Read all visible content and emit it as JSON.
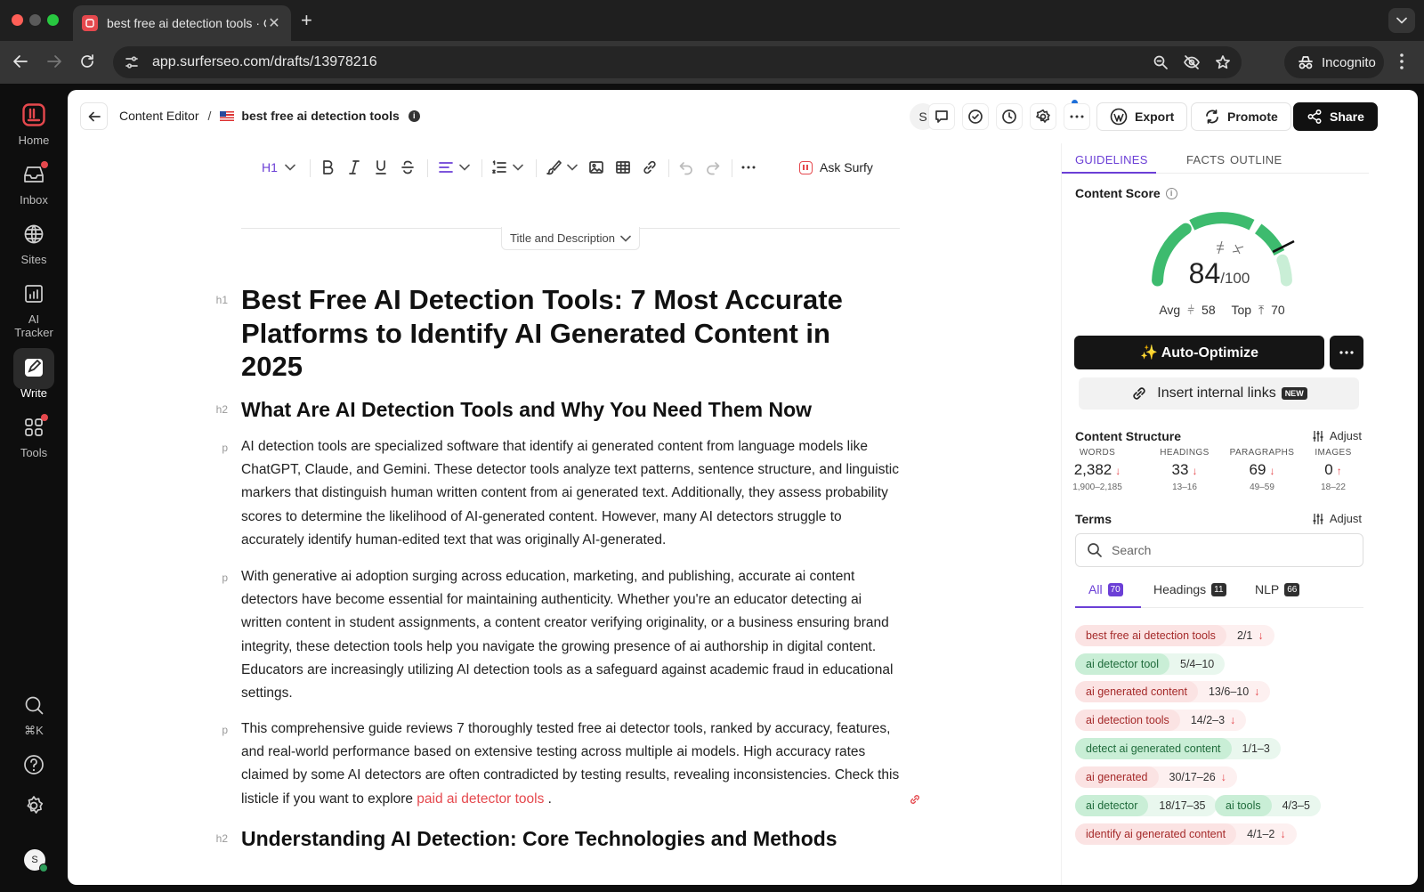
{
  "browser": {
    "tab_title": "best free ai detection tools · Content Editor",
    "url": "app.surferseo.com/drafts/13978216",
    "incognito_label": "Incognito"
  },
  "sidebar": {
    "items": [
      {
        "label": "Home",
        "icon": "home-icon"
      },
      {
        "label": "Inbox",
        "icon": "inbox-icon"
      },
      {
        "label": "Sites",
        "icon": "globe-icon"
      },
      {
        "label": "AI Tracker",
        "icon": "chart-icon"
      },
      {
        "label": "Write",
        "icon": "write-icon"
      },
      {
        "label": "Tools",
        "icon": "grid-icon"
      }
    ],
    "shortcut": "⌘K",
    "avatar_initial": "S"
  },
  "header": {
    "breadcrumb_root": "Content Editor",
    "breadcrumb_sep": "/",
    "doc_title": "best free ai detection tools",
    "user_badge": "S",
    "export_label": "Export",
    "promote_label": "Promote",
    "share_label": "Share"
  },
  "editor": {
    "heading_select": "H1",
    "ask_surfy": "Ask Surfy",
    "title_desc_toggle": "Title and Description",
    "blocks": [
      {
        "tag": "h1",
        "text": "Best Free AI Detection Tools: 7 Most Accurate Platforms to Identify AI Generated Content in 2025"
      },
      {
        "tag": "h2",
        "text": "What Are AI Detection Tools and Why You Need Them Now"
      },
      {
        "tag": "p",
        "text": "AI detection tools are specialized software that identify ai generated content from language models like ChatGPT, Claude, and Gemini. These detector tools analyze text patterns, sentence structure, and linguistic markers that distinguish human written content from ai generated text. Additionally, they assess probability scores to determine the likelihood of AI-generated content. However, many AI detectors struggle to accurately identify human-edited text that was originally AI-generated."
      },
      {
        "tag": "p",
        "text": "With generative ai adoption surging across education, marketing, and publishing, accurate ai content detectors have become essential for maintaining authenticity. Whether you're an educator detecting ai written content in student assignments, a content creator verifying originality, or a business ensuring brand integrity, these detection tools help you navigate the growing presence of ai authorship in digital content. Educators are increasingly utilizing AI detection tools as a safeguard against academic fraud in educational settings."
      },
      {
        "tag": "p",
        "text": "This comprehensive guide reviews 7 thoroughly tested free ai detector tools, ranked by accuracy, features, and real-world performance based on extensive testing across multiple ai models. High accuracy rates claimed by some AI detectors are often contradicted by testing results, revealing inconsistencies. Check this listicle if you want to explore ",
        "link": "paid ai detector tools",
        "after": " ."
      },
      {
        "tag": "h2",
        "text": "Understanding AI Detection: Core Technologies and Methods"
      }
    ]
  },
  "guidelines": {
    "tabs": [
      "GUIDELINES",
      "FACTS",
      "OUTLINE"
    ],
    "content_score_label": "Content Score",
    "score": 84,
    "score_max": "/100",
    "avg_label": "Avg",
    "avg_value": "58",
    "top_label": "Top",
    "top_value": "70",
    "auto_optimize": "✨ Auto-Optimize",
    "insert_links": "Insert internal links",
    "new_badge": "NEW",
    "structure_title": "Content Structure",
    "adjust_label": "Adjust",
    "stats": [
      {
        "label": "WORDS",
        "value": "2,382",
        "dir": "↓",
        "range": "1,900–2,185"
      },
      {
        "label": "HEADINGS",
        "value": "33",
        "dir": "↓",
        "range": "13–16"
      },
      {
        "label": "PARAGRAPHS",
        "value": "69",
        "dir": "↓",
        "range": "49–59"
      },
      {
        "label": "IMAGES",
        "value": "0",
        "dir": "↑",
        "range": "18–22"
      }
    ],
    "terms_title": "Terms",
    "search_placeholder": "Search",
    "term_tabs": [
      {
        "label": "All",
        "count": "70"
      },
      {
        "label": "Headings",
        "count": "11"
      },
      {
        "label": "NLP",
        "count": "66"
      }
    ],
    "terms": [
      {
        "term": "best free ai detection tools",
        "count": "2/1",
        "dir": "↓",
        "status": "red"
      },
      {
        "term": "ai detector tool",
        "count": "5/4–10",
        "dir": "",
        "status": "green"
      },
      {
        "term": "ai generated content",
        "count": "13/6–10",
        "dir": "↓",
        "status": "red"
      },
      {
        "term": "ai detection tools",
        "count": "14/2–3",
        "dir": "↓",
        "status": "red"
      },
      {
        "term": "detect ai generated content",
        "count": "1/1–3",
        "dir": "",
        "status": "green"
      },
      {
        "term": "ai generated",
        "count": "30/17–26",
        "dir": "↓",
        "status": "red"
      },
      {
        "term": "ai detector",
        "count": "18/17–35",
        "dir": "",
        "status": "green"
      },
      {
        "term": "ai tools",
        "count": "4/3–5",
        "dir": "",
        "status": "green"
      },
      {
        "term": "identify ai generated content",
        "count": "4/1–2",
        "dir": "↓",
        "status": "red"
      }
    ]
  },
  "colors": {
    "accent": "#6b3fd6",
    "brand": "#e5484d",
    "gauge_green": "#3dbb6e",
    "over": "#e5484d"
  }
}
